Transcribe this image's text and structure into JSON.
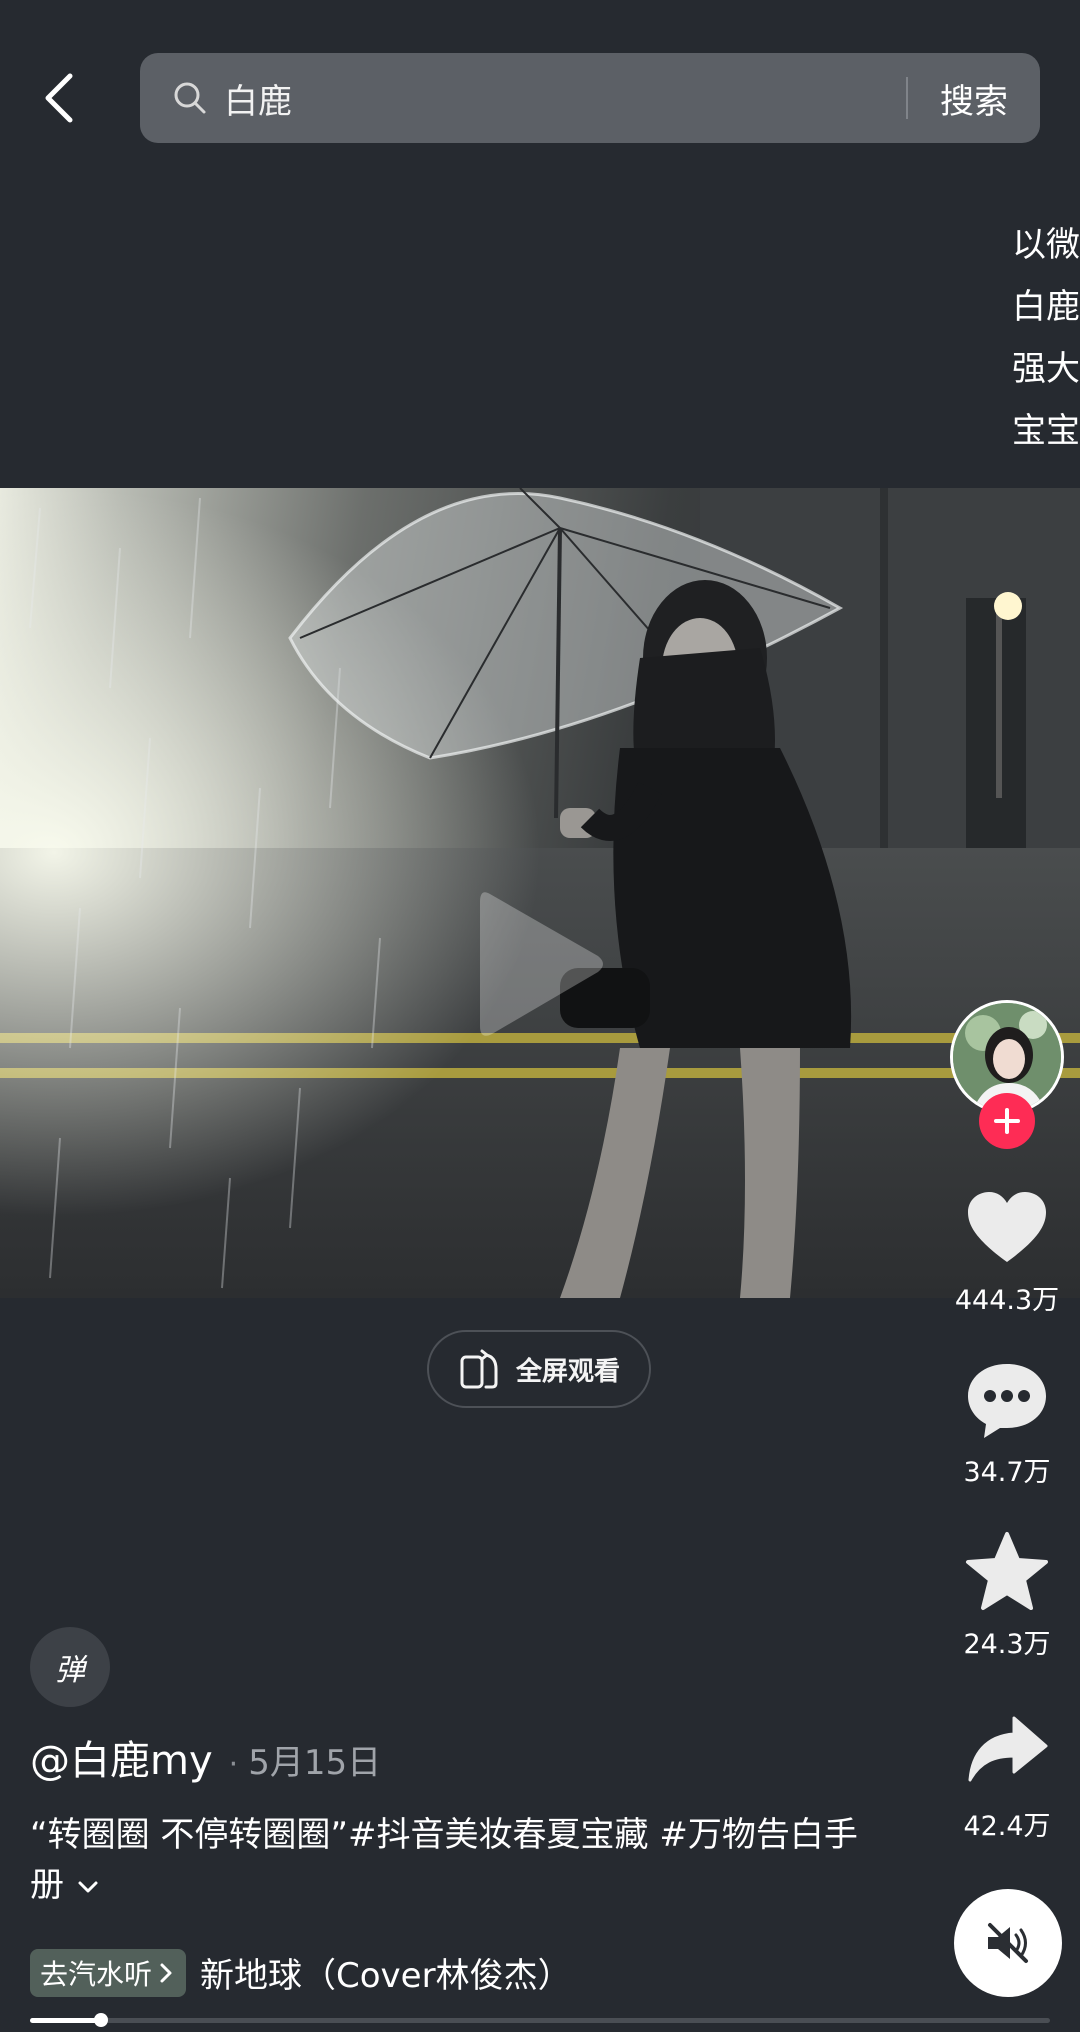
{
  "search": {
    "query": "白鹿",
    "submit_label": "搜索"
  },
  "side_description": {
    "lines": [
      "以微",
      "白鹿",
      "强大",
      "宝宝"
    ]
  },
  "fullscreen": {
    "label": "全屏观看"
  },
  "actions": {
    "like_count": "444.3万",
    "comment_count": "34.7万",
    "favorite_count": "24.3万",
    "share_count": "42.4万"
  },
  "video": {
    "danmu_label": "弹",
    "author": "@白鹿my",
    "separator": "·",
    "date": "5月15日",
    "description": "“转圈圈 不停转圈圈”#抖音美妆春夏宝藏 #万物告白手册",
    "music_tag": "去汽水听",
    "music_title": "新地球（Cover林俊杰）",
    "progress": 0.07
  },
  "colors": {
    "background": "#262a30",
    "follow_accent": "#fe2c55"
  },
  "icons": [
    "back-arrow-icon",
    "search-icon",
    "play-icon",
    "fullscreen-rotate-icon",
    "heart-icon",
    "comment-icon",
    "star-icon",
    "share-icon",
    "mute-icon",
    "plus-icon",
    "chevron-down-icon",
    "chevron-right-icon"
  ]
}
